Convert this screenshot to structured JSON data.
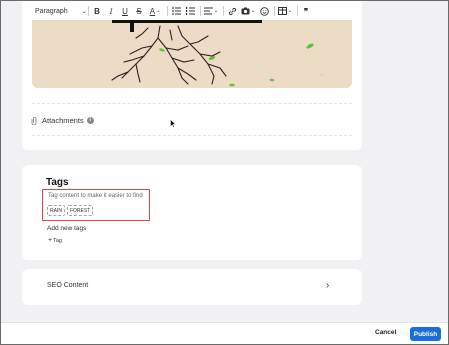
{
  "toolbar": {
    "paragraph_style": "Paragraph",
    "bold": "B",
    "italic": "I",
    "underline": "U",
    "strikethrough": "S",
    "text_color": "A",
    "quote": "❞",
    "icons": [
      "bold-icon",
      "italic-icon",
      "underline-icon",
      "strikethrough-icon",
      "text-color-icon",
      "bulleted-list-icon",
      "numbered-list-icon",
      "align-icon",
      "link-icon",
      "image-icon",
      "emoji-icon",
      "table-icon",
      "quote-icon"
    ]
  },
  "attachments": {
    "label": "Attachments",
    "info_glyph": "i"
  },
  "tags": {
    "title": "Tags",
    "hint": "Tag content to make it easier to find",
    "items": [
      "RAIN",
      "FOREST"
    ],
    "add_new_label": "Add new tags",
    "add_tag_button": "Tag",
    "highlight_color": "#d84a3f"
  },
  "seo": {
    "title": "SEO Content"
  },
  "footer": {
    "cancel_label": "Cancel",
    "publish_label": "Publish",
    "publish_color": "#1a6fd6"
  }
}
